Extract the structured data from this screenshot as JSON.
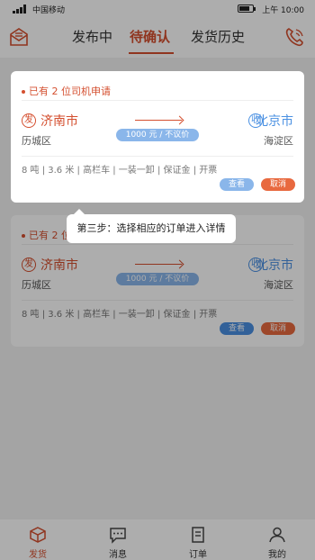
{
  "status_bar": {
    "carrier": "中国移动",
    "time": "上午 10:00"
  },
  "header": {
    "tabs": [
      {
        "label": "发布中"
      },
      {
        "label": "待确认"
      },
      {
        "label": "发货历史"
      }
    ],
    "active_tab": "待确认",
    "left_icon": "envelope-icon",
    "right_icon": "phone-icon"
  },
  "orders": [
    {
      "applicants": "已有 2 位司机申请",
      "from_badge": "发",
      "from_city": "济南市",
      "from_district": "历城区",
      "to_badge": "收",
      "to_city": "北京市",
      "to_district": "海淀区",
      "price": "1000 元 / 不议价",
      "specs": "8 吨 | 3.6 米 | 高栏车 | 一装一卸 | 保证金 | 开票",
      "view_label": "查看",
      "cancel_label": "取消"
    },
    {
      "applicants": "已有 2 位司机申请",
      "from_badge": "发",
      "from_city": "济南市",
      "from_district": "历城区",
      "to_badge": "收",
      "to_city": "北京市",
      "to_district": "海淀区",
      "price": "1000 元 / 不议价",
      "specs": "8 吨 | 3.6 米 | 高栏车 | 一装一卸 | 保证金 | 开票",
      "view_label": "查看",
      "cancel_label": "取消"
    }
  ],
  "guide": {
    "text": "第三步：选择相应的订单进入详情"
  },
  "bottom_nav": [
    {
      "label": "发货",
      "icon": "box-icon"
    },
    {
      "label": "消息",
      "icon": "message-icon"
    },
    {
      "label": "订单",
      "icon": "document-icon"
    },
    {
      "label": "我的",
      "icon": "person-icon"
    }
  ],
  "colors": {
    "accent": "#d44f2f",
    "blue": "#4a90e2",
    "cancel": "#e8693f"
  }
}
